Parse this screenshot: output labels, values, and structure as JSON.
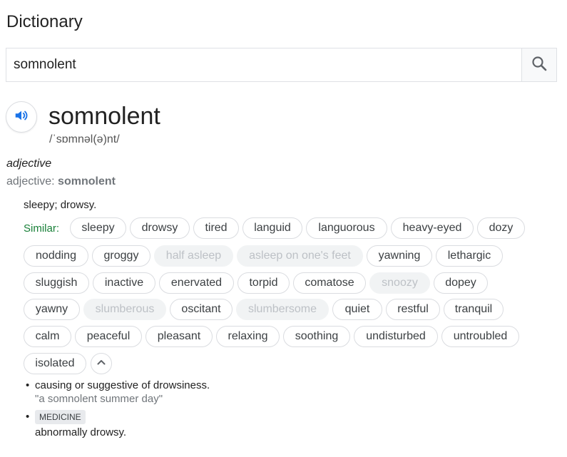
{
  "header": {
    "title": "Dictionary"
  },
  "search": {
    "value": "somnolent"
  },
  "entry": {
    "word": "somnolent",
    "phonetic": "/ˈsɒmnəl(ə)nt/",
    "pos": "adjective",
    "pos_prefix": "adjective: ",
    "pos_word": "somnolent"
  },
  "sense1": {
    "definition": "sleepy; drowsy.",
    "similar_label": "Similar:",
    "chips": [
      {
        "label": "sleepy",
        "muted": false
      },
      {
        "label": "drowsy",
        "muted": false
      },
      {
        "label": "tired",
        "muted": false
      },
      {
        "label": "languid",
        "muted": false
      },
      {
        "label": "languorous",
        "muted": false
      },
      {
        "label": "heavy-eyed",
        "muted": false
      },
      {
        "label": "dozy",
        "muted": false
      },
      {
        "label": "nodding",
        "muted": false
      },
      {
        "label": "groggy",
        "muted": false
      },
      {
        "label": "half asleep",
        "muted": true
      },
      {
        "label": "asleep on one's feet",
        "muted": true
      },
      {
        "label": "yawning",
        "muted": false
      },
      {
        "label": "lethargic",
        "muted": false
      },
      {
        "label": "sluggish",
        "muted": false
      },
      {
        "label": "inactive",
        "muted": false
      },
      {
        "label": "enervated",
        "muted": false
      },
      {
        "label": "torpid",
        "muted": false
      },
      {
        "label": "comatose",
        "muted": false
      },
      {
        "label": "snoozy",
        "muted": true
      },
      {
        "label": "dopey",
        "muted": false
      },
      {
        "label": "yawny",
        "muted": false
      },
      {
        "label": "slumberous",
        "muted": true
      },
      {
        "label": "oscitant",
        "muted": false
      },
      {
        "label": "slumbersome",
        "muted": true
      },
      {
        "label": "quiet",
        "muted": false
      },
      {
        "label": "restful",
        "muted": false
      },
      {
        "label": "tranquil",
        "muted": false
      },
      {
        "label": "calm",
        "muted": false
      },
      {
        "label": "peaceful",
        "muted": false
      },
      {
        "label": "pleasant",
        "muted": false
      },
      {
        "label": "relaxing",
        "muted": false
      },
      {
        "label": "soothing",
        "muted": false
      },
      {
        "label": "undisturbed",
        "muted": false
      },
      {
        "label": "untroubled",
        "muted": false
      },
      {
        "label": "isolated",
        "muted": false
      }
    ]
  },
  "sense2": {
    "bullet": "•",
    "definition": "causing or suggestive of drowsiness.",
    "example": "\"a somnolent summer day\""
  },
  "sense3": {
    "bullet": "•",
    "label": "MEDICINE",
    "definition": "abnormally drowsy."
  },
  "icons": {
    "search": "search-icon",
    "speaker": "speaker-icon",
    "collapse": "chevron-up-icon"
  },
  "colors": {
    "accent": "#1a73e8",
    "similar_label": "#188038",
    "muted_text": "#70757a"
  }
}
